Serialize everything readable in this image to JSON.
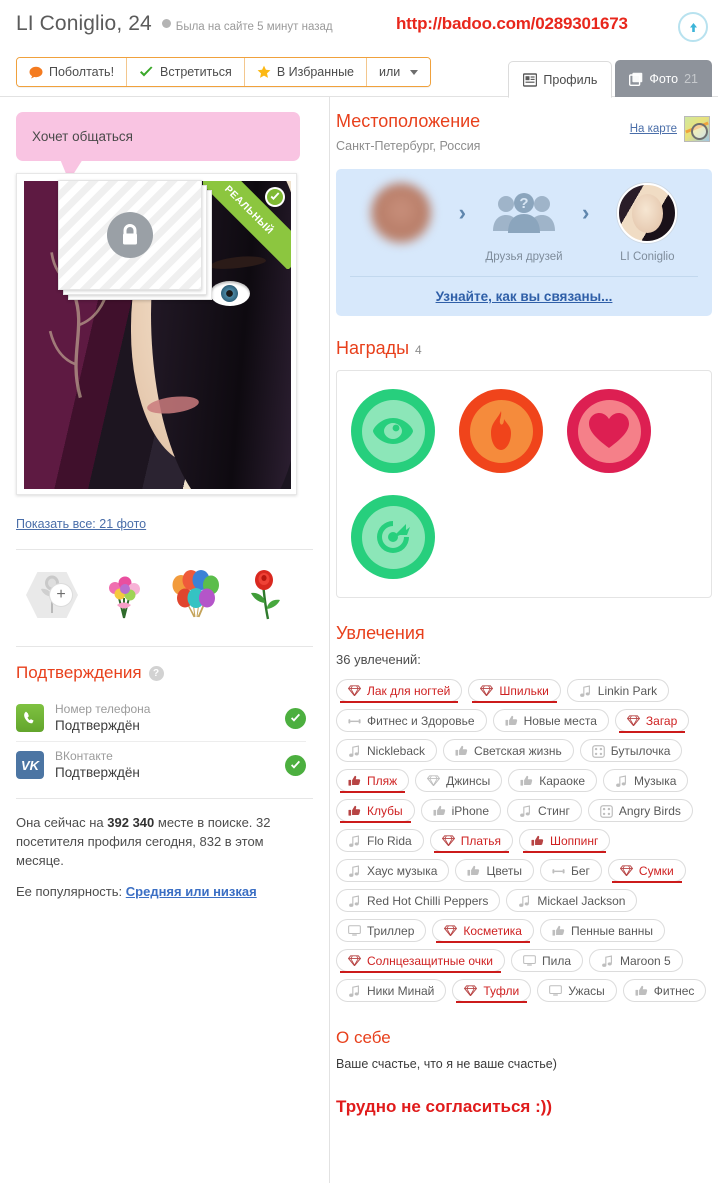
{
  "header": {
    "profile_name": "LI Coniglio, 24",
    "last_seen": "Была на сайте 5 минут назад",
    "url_annotation": "http://badoo.com/0289301673",
    "scroll_top_icon": "arrow-up-icon",
    "actions": [
      {
        "label": "Поболтать!",
        "icon": "chat-bubble-icon"
      },
      {
        "label": "Встретиться",
        "icon": "check-icon"
      },
      {
        "label": "В Избранные",
        "icon": "star-icon"
      },
      {
        "label": "или",
        "icon": "chevron-down-icon"
      }
    ],
    "tabs": [
      {
        "label": "Профиль",
        "icon": "profile-card-icon",
        "count": "",
        "active": true
      },
      {
        "label": "Фото",
        "icon": "photos-icon",
        "count": "21",
        "active": false
      }
    ]
  },
  "left": {
    "status_bubble": "Хочет общаться",
    "photo_ribbon": "РЕАЛЬНЫЙ",
    "locked_photos_icon": "lock-icon",
    "show_all_photos": "Показать все: 21 фото",
    "gifts": [
      {
        "name": "add-gift",
        "icon": "plus-icon"
      },
      {
        "name": "bouquet-gift",
        "icon": "bouquet-icon"
      },
      {
        "name": "balloons-gift",
        "icon": "balloons-icon"
      },
      {
        "name": "rose-gift",
        "icon": "rose-icon"
      }
    ],
    "verifications_title": "Подтверждения",
    "verifications_help": "?",
    "verifications": [
      {
        "label": "Номер телефона",
        "value": "Подтверждён",
        "icon": "phone-icon",
        "status": "verified"
      },
      {
        "label": "ВКонтакте",
        "value": "Подтверждён",
        "icon": "vk-icon",
        "status": "verified"
      }
    ],
    "stats_prefix": "Она сейчас на ",
    "stats_rank": "392 340",
    "stats_suffix": " месте в поиске. 32 посетителя профиля сегодня, 832 в этом месяце.",
    "popularity_label": "Ее популярность: ",
    "popularity_value": "Средняя или низкая"
  },
  "right": {
    "location_title": "Местоположение",
    "location_value": "Санкт-Петербург, Россия",
    "map_link": "На карте",
    "map_icon": "map-magnifier-icon",
    "connection": {
      "you_name": "",
      "middle_label": "Друзья друзей",
      "middle_icon": "friends-question-icon",
      "target_name": "LI Coniglio",
      "cta": "Узнайте, как вы связаны..."
    },
    "awards_title": "Награды",
    "awards_count": "4",
    "awards": [
      {
        "name": "popular-eye-award",
        "icon": "eye-icon",
        "ring": "#27cf7d",
        "fill": "#8ce6b8",
        "glyph": "#27cf7d"
      },
      {
        "name": "hot-flame-award",
        "icon": "flame-icon",
        "ring": "#f0441b",
        "fill": "#f58b3c",
        "glyph": "#f0441b"
      },
      {
        "name": "loved-heart-award",
        "icon": "heart-icon",
        "ring": "#dd1f52",
        "fill": "#f58089",
        "glyph": "#dd1f52"
      },
      {
        "name": "target-award",
        "icon": "target-icon",
        "ring": "#27cf7d",
        "fill": "#8ce6b8",
        "glyph": "#27cf7d"
      }
    ],
    "interests_title": "Увлечения",
    "interests_count": "36 увлечений:",
    "interests": [
      {
        "label": "Лак для ногтей",
        "icon": "diamond-icon",
        "highlighted": true
      },
      {
        "label": "Шпильки",
        "icon": "diamond-icon",
        "highlighted": true
      },
      {
        "label": "Linkin Park",
        "icon": "music-note-icon",
        "highlighted": false
      },
      {
        "label": "Фитнес и Здоровье",
        "icon": "dumbbell-icon",
        "highlighted": false
      },
      {
        "label": "Новые места",
        "icon": "thumbs-up-icon",
        "highlighted": false
      },
      {
        "label": "Загар",
        "icon": "diamond-icon",
        "highlighted": true
      },
      {
        "label": "Nickleback",
        "icon": "music-note-icon",
        "highlighted": false
      },
      {
        "label": "Светская жизнь",
        "icon": "thumbs-up-icon",
        "highlighted": false
      },
      {
        "label": "Бутылочка",
        "icon": "dice-icon",
        "highlighted": false
      },
      {
        "label": "Пляж",
        "icon": "thumbs-up-icon",
        "highlighted": true
      },
      {
        "label": "Джинсы",
        "icon": "diamond-icon",
        "highlighted": false
      },
      {
        "label": "Караоке",
        "icon": "thumbs-up-icon",
        "highlighted": false
      },
      {
        "label": "Музыка",
        "icon": "music-note-icon",
        "highlighted": false
      },
      {
        "label": "Клубы",
        "icon": "thumbs-up-icon",
        "highlighted": true
      },
      {
        "label": "iPhone",
        "icon": "thumbs-up-icon",
        "highlighted": false
      },
      {
        "label": "Стинг",
        "icon": "music-note-icon",
        "highlighted": false
      },
      {
        "label": "Angry Birds",
        "icon": "dice-icon",
        "highlighted": false
      },
      {
        "label": "Flo Rida",
        "icon": "music-note-icon",
        "highlighted": false
      },
      {
        "label": "Платья",
        "icon": "diamond-icon",
        "highlighted": true
      },
      {
        "label": "Шоппинг",
        "icon": "thumbs-up-icon",
        "highlighted": true
      },
      {
        "label": "Хаус музыка",
        "icon": "music-note-icon",
        "highlighted": false
      },
      {
        "label": "Цветы",
        "icon": "thumbs-up-icon",
        "highlighted": false
      },
      {
        "label": "Бег",
        "icon": "dumbbell-icon",
        "highlighted": false
      },
      {
        "label": "Сумки",
        "icon": "diamond-icon",
        "highlighted": true
      },
      {
        "label": "Red Hot Chilli Peppers",
        "icon": "music-note-icon",
        "highlighted": false
      },
      {
        "label": "Mickael Jackson",
        "icon": "music-note-icon",
        "highlighted": false
      },
      {
        "label": "Триллер",
        "icon": "tv-icon",
        "highlighted": false
      },
      {
        "label": "Косметика",
        "icon": "diamond-icon",
        "highlighted": true
      },
      {
        "label": "Пенные ванны",
        "icon": "thumbs-up-icon",
        "highlighted": false
      },
      {
        "label": "Солнцезащитные очки",
        "icon": "diamond-icon",
        "highlighted": true
      },
      {
        "label": "Пила",
        "icon": "tv-icon",
        "highlighted": false
      },
      {
        "label": "Maroon 5",
        "icon": "music-note-icon",
        "highlighted": false
      },
      {
        "label": "Ники Минай",
        "icon": "music-note-icon",
        "highlighted": false
      },
      {
        "label": "Туфли",
        "icon": "diamond-icon",
        "highlighted": true
      },
      {
        "label": "Ужасы",
        "icon": "tv-icon",
        "highlighted": false
      },
      {
        "label": "Фитнес",
        "icon": "thumbs-up-icon",
        "highlighted": false
      }
    ],
    "about_title": "О себе",
    "about_text": "Ваше счастье, что я не ваше счастье)",
    "annotation": "Трудно не согласиться :))"
  },
  "colors": {
    "accent_red": "#e8401c",
    "link_blue": "#4a6ea9",
    "url_red": "#e8271c",
    "bubble_pink": "#f9c4e2",
    "connection_bg": "#d7e8fb",
    "highlight_underline": "#cc1b1b"
  }
}
